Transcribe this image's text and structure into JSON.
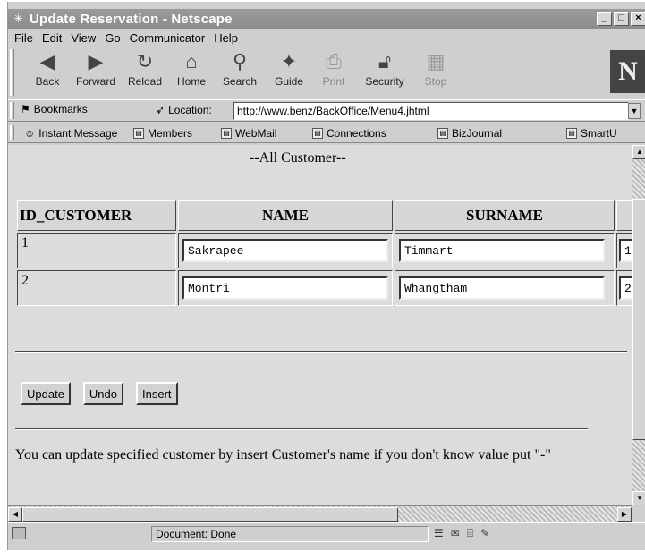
{
  "window": {
    "title": "Update Reservation - Netscape",
    "controls": [
      "_",
      "□",
      "×"
    ]
  },
  "menu": [
    "File",
    "Edit",
    "View",
    "Go",
    "Communicator",
    "Help"
  ],
  "navigation": [
    {
      "label": "Back",
      "icon": "back-arrow-icon"
    },
    {
      "label": "Forward",
      "icon": "forward-arrow-icon"
    },
    {
      "label": "Reload",
      "icon": "reload-icon"
    },
    {
      "label": "Home",
      "icon": "home-icon"
    },
    {
      "label": "Search",
      "icon": "search-icon"
    },
    {
      "label": "Guide",
      "icon": "guide-icon"
    },
    {
      "label": "Print",
      "icon": "print-icon"
    },
    {
      "label": "Security",
      "icon": "lock-icon"
    },
    {
      "label": "Stop",
      "icon": "stop-icon"
    }
  ],
  "brand_logo": "N",
  "location": {
    "bookmarks_label": "Bookmarks",
    "location_label": "Location:",
    "url": "http://www.benz/BackOffice/Menu4.jhtml"
  },
  "personal_toolbar": [
    "Instant Message",
    "Members",
    "WebMail",
    "Connections",
    "BizJournal",
    "SmartU"
  ],
  "page": {
    "heading": "--All Customer--",
    "columns": [
      "ID_CUSTOMER",
      "NAME",
      "SURNAME"
    ],
    "rows": [
      {
        "id": "1",
        "name": "Sakrapee",
        "surname": "Timmart",
        "extra": "1"
      },
      {
        "id": "2",
        "name": "Montri",
        "surname": "Whangtham",
        "extra": "2"
      }
    ],
    "buttons": {
      "update": "Update",
      "undo": "Undo",
      "insert": "Insert"
    },
    "help": "You can update specified customer by insert Customer's name if you don't know value put \"-\""
  },
  "status": {
    "text": "Document: Done"
  }
}
